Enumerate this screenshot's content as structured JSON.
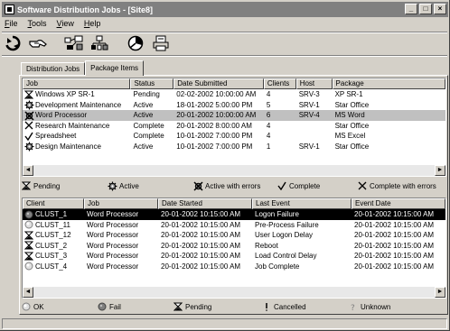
{
  "window": {
    "title": "Software Distribution Jobs - [Site8]",
    "minimize": "_",
    "maximize": "□",
    "close": "×"
  },
  "menu": [
    "File",
    "Tools",
    "View",
    "Help"
  ],
  "toolbar": [
    "refresh-icon",
    "hand-icon",
    "network-icon",
    "tree-icon",
    "pie-chart-icon",
    "print-icon"
  ],
  "tabs": [
    {
      "label": "Distribution Jobs",
      "active": false
    },
    {
      "label": "Package Items",
      "active": true
    }
  ],
  "jobs": {
    "columns": [
      "Job",
      "Status",
      "Date Submitted",
      "Clients",
      "Host",
      "Package"
    ],
    "rows": [
      {
        "icon": "pending",
        "job": "Windows XP SR-1",
        "status": "Pending",
        "date": "02-02-2002 10:00:00 AM",
        "clients": "4",
        "host": "SRV-3",
        "package": "XP SR-1",
        "selected": false
      },
      {
        "icon": "active",
        "job": "Development Maintenance",
        "status": "Active",
        "date": "18-01-2002 5:00:00 PM",
        "clients": "5",
        "host": "SRV-1",
        "package": "Star Office",
        "selected": false
      },
      {
        "icon": "active-errors",
        "job": "Word Processor",
        "status": "Active",
        "date": "20-01-2002 10:00:00 AM",
        "clients": "6",
        "host": "SRV-4",
        "package": "MS Word",
        "selected": true
      },
      {
        "icon": "complete-errors",
        "job": "Research Maintenance",
        "status": "Complete",
        "date": "20-01-2002 8:00:00 AM",
        "clients": "4",
        "host": "",
        "package": "Star Office",
        "selected": false
      },
      {
        "icon": "complete",
        "job": "Spreadsheet",
        "status": "Complete",
        "date": "10-01-2002 7:00:00 PM",
        "clients": "4",
        "host": "",
        "package": "MS Excel",
        "selected": false
      },
      {
        "icon": "active",
        "job": "Design Maintenance",
        "status": "Active",
        "date": "10-01-2002 7:00:00 PM",
        "clients": "1",
        "host": "SRV-1",
        "package": "Star Office",
        "selected": false
      }
    ]
  },
  "job_legend": [
    {
      "icon": "pending",
      "label": "Pending"
    },
    {
      "icon": "active",
      "label": "Active"
    },
    {
      "icon": "active-errors",
      "label": "Active with errors"
    },
    {
      "icon": "complete",
      "label": "Complete"
    },
    {
      "icon": "complete-errors",
      "label": "Complete with errors"
    }
  ],
  "clients": {
    "columns": [
      "Client",
      "Job",
      "Date Started",
      "Last Event",
      "Event Date"
    ],
    "rows": [
      {
        "icon": "fail",
        "client": "CLUST_1",
        "job": "Word Processor",
        "started": "20-01-2002 10:15:00 AM",
        "event": "Logon Failure",
        "event_date": "20-01-2002 10:15:00 AM",
        "selected": true
      },
      {
        "icon": "ok",
        "client": "CLUST_11",
        "job": "Word Processor",
        "started": "20-01-2002 10:15:00 AM",
        "event": "Pre-Process Failure",
        "event_date": "20-01-2002 10:15:00 AM",
        "selected": false
      },
      {
        "icon": "pending",
        "client": "CLUST_12",
        "job": "Word Processor",
        "started": "20-01-2002 10:15:00 AM",
        "event": "User Logon Delay",
        "event_date": "20-01-2002 10:15:00 AM",
        "selected": false
      },
      {
        "icon": "pending",
        "client": "CLUST_2",
        "job": "Word Processor",
        "started": "20-01-2002 10:15:00 AM",
        "event": "Reboot",
        "event_date": "20-01-2002 10:15:00 AM",
        "selected": false
      },
      {
        "icon": "pending",
        "client": "CLUST_3",
        "job": "Word Processor",
        "started": "20-01-2002 10:15:00 AM",
        "event": "Load Control Delay",
        "event_date": "20-01-2002 10:15:00 AM",
        "selected": false
      },
      {
        "icon": "ok",
        "client": "CLUST_4",
        "job": "Word Processor",
        "started": "20-01-2002 10:15:00 AM",
        "event": "Job Complete",
        "event_date": "20-01-2002 10:15:00 AM",
        "selected": false
      }
    ]
  },
  "client_legend": [
    {
      "icon": "ok",
      "label": "OK"
    },
    {
      "icon": "fail",
      "label": "Fail"
    },
    {
      "icon": "pending",
      "label": "Pending"
    },
    {
      "icon": "cancelled",
      "label": "Cancelled"
    },
    {
      "icon": "unknown",
      "label": "Unknown"
    }
  ],
  "scroll": {
    "left": "◄",
    "right": "►"
  }
}
